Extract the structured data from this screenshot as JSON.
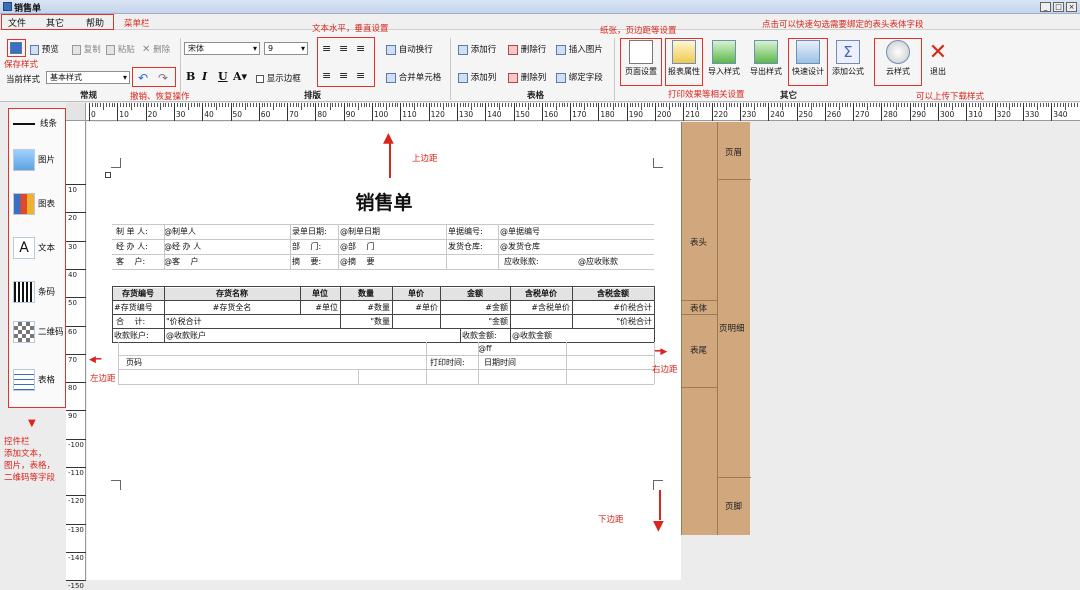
{
  "window": {
    "title": "销售单"
  },
  "menu": [
    "文件",
    "其它",
    "帮助"
  ],
  "toolbar": {
    "preview": "预览",
    "copy": "复制",
    "paste": "粘贴",
    "delete": "删除",
    "current_style_label": "当前样式",
    "current_style_value": "基本样式",
    "font_value": "宋体",
    "font_size": "9",
    "show_border": "显示边框",
    "auto_wrap": "自动换行",
    "merge_cells": "合并单元格",
    "add_row": "添加行",
    "del_row": "删除行",
    "insert_image": "插入图片",
    "add_col": "添加列",
    "del_col": "删除列",
    "bind_field": "绑定字段",
    "page_setup": "页面设置",
    "report_props": "报表属性",
    "import_style": "导入样式",
    "export_style": "导出样式",
    "quick_design": "快速设计",
    "add_formula": "添加公式",
    "cloud_style": "云样式",
    "exit": "退出",
    "group_common": "常规",
    "group_layout": "排版",
    "group_table": "表格",
    "group_other": "其它"
  },
  "ruler": {
    "h_ticks": [
      "0",
      "10",
      "20",
      "30",
      "40",
      "50",
      "60",
      "70",
      "80",
      "90",
      "100",
      "110",
      "120",
      "130",
      "140",
      "150",
      "160",
      "170",
      "180",
      "190",
      "200",
      "210",
      "220",
      "230",
      "240",
      "250",
      "260",
      "270",
      "280",
      "290",
      "300",
      "310",
      "320",
      "330",
      "340"
    ],
    "v_ticks": [
      "10",
      "20",
      "30",
      "40",
      "50",
      "60",
      "70",
      "80",
      "90",
      "-100",
      "-110",
      "-120",
      "-130",
      "-140",
      "-150"
    ]
  },
  "sidebar": {
    "items": [
      "线条",
      "图片",
      "图表",
      "文本",
      "条码",
      "二维码",
      "表格"
    ]
  },
  "bands": {
    "header": "页眉",
    "table_head": "表头",
    "table_body": "表体",
    "table_foot": "表尾",
    "detail": "页明细",
    "footer": "页脚"
  },
  "report": {
    "title": "销售单",
    "info": [
      [
        "制 单 人:",
        "@制单人",
        "录单日期:",
        "@制单日期",
        "单据编号:",
        "@单据编号"
      ],
      [
        "经 办 人:",
        "@经 办 人",
        "部　 门:",
        "@部　 门",
        "发货仓库:",
        "@发货仓库"
      ],
      [
        "客　 户:",
        "@客　 户",
        "摘　 要:",
        "@摘　 要",
        "应收账款:",
        "@应收账款"
      ]
    ],
    "columns": [
      "存货编号",
      "存货名称",
      "单位",
      "数量",
      "单价",
      "金额",
      "含税单价",
      "含税金额"
    ],
    "row": [
      "#存货编号",
      "#存货全名",
      "#单位",
      "#数量",
      "#单价",
      "#金额",
      "#含税单价",
      "#价税合计"
    ],
    "total": {
      "label": "合　 计:",
      "value": "\"价税合计",
      "qty": "\"数量",
      "amount": "\"金额",
      "tax_total": "\"价税合计"
    },
    "payment": {
      "label": "收款账户:",
      "value": "@收款账户",
      "amount_label": "收款金额:",
      "amount_value": "@收款金额"
    },
    "footer_code": "@ff",
    "page_code": "页码",
    "print_time_label": "打印时间:",
    "print_time_value": "日期时间"
  },
  "annotations": {
    "menubar": "菜单栏",
    "save_style": "保存样式",
    "text_align": "文本水平，垂直设置",
    "paper": "纸张，页边距等设置",
    "quick": "点击可以快速勾选需要绑定的表头表体字段",
    "undo": "撤销、恢复操作",
    "print_effect": "打印效果等相关设置",
    "upload": "可以上传下载样式",
    "top_margin": "上边距",
    "left_margin": "左边距",
    "right_margin": "右边距",
    "bottom_margin": "下边距",
    "controls": [
      "控件栏",
      "添加文本，",
      "图片，表格，",
      "二维码等字段"
    ]
  }
}
